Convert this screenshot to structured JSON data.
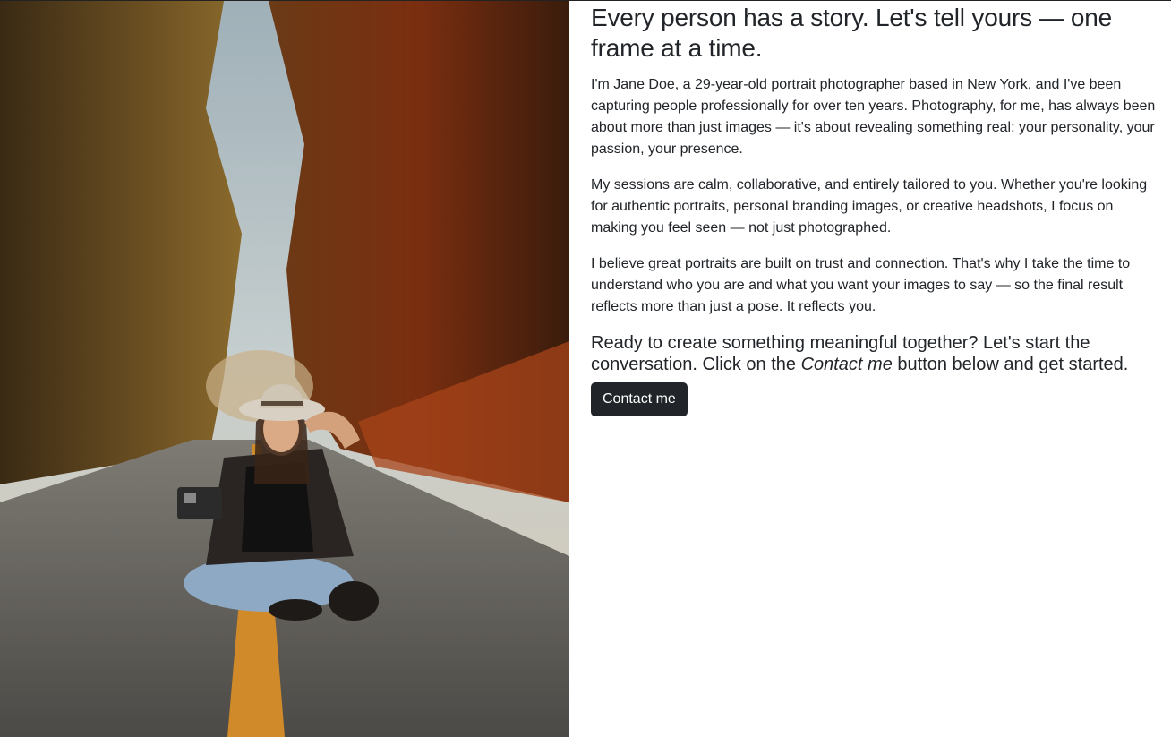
{
  "hero": {
    "image_alt": "Portrait of a smiling woman in a wide-brim hat sitting cross-legged on a forest road, holding an instant camera"
  },
  "about": {
    "headline": "Every person has a story. Let's tell yours — one frame at a time.",
    "paragraphs": [
      "I'm Jane Doe, a 29-year-old portrait photographer based in New York, and I've been capturing people professionally for over ten years. Photography, for me, has always been about more than just images — it's about revealing something real: your personality, your passion, your presence.",
      "My sessions are calm, collaborative, and entirely tailored to you. Whether you're looking for authentic portraits, personal branding images, or creative headshots, I focus on making you feel seen — not just photographed.",
      "I believe great portraits are built on trust and connection. That's why I take the time to understand who you are and what you want your images to say — so the final result reflects more than just a pose. It reflects you."
    ],
    "cta_before": "Ready to create something meaningful together? Let's start the conversation. Click on the ",
    "cta_emphasis": "Contact me",
    "cta_after": " button below and get started.",
    "button_label": "Contact me"
  }
}
